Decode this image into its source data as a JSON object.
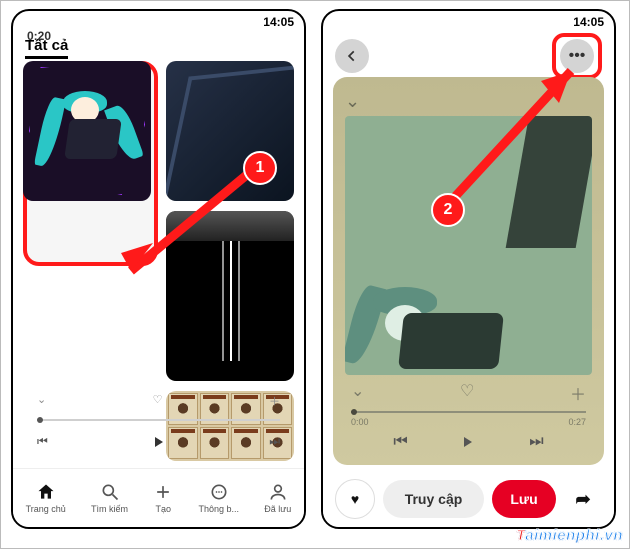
{
  "status_time": "14:05",
  "left": {
    "tab_all": "Tất cả",
    "tile2_more": "•••",
    "music_pin": {
      "duration": "0:20",
      "icon_down": "⌄",
      "icon_heart": "♡",
      "icon_plus": "＋",
      "btn_prev": "⏮",
      "btn_next": "⏭"
    },
    "nav": {
      "home": "Trang chủ",
      "search": "Tìm kiếm",
      "create": "Tạo",
      "notif": "Thông b...",
      "saved": "Đã lưu"
    }
  },
  "right": {
    "more_dots": "•••",
    "chevron": "⌄",
    "icons": {
      "down": "⌄",
      "heart": "♡",
      "plus": "＋"
    },
    "time_start": "0:00",
    "time_end": "0:27",
    "ctl": {
      "prev": "⏮",
      "next": "⏭"
    },
    "bar": {
      "react": "♥",
      "visit": "Truy cập",
      "save": "Lưu",
      "share": "➦"
    }
  },
  "callouts": {
    "one": "1",
    "two": "2"
  },
  "watermark": {
    "t": "T",
    "rest": "aimienphi",
    "suffix": ".vn"
  }
}
